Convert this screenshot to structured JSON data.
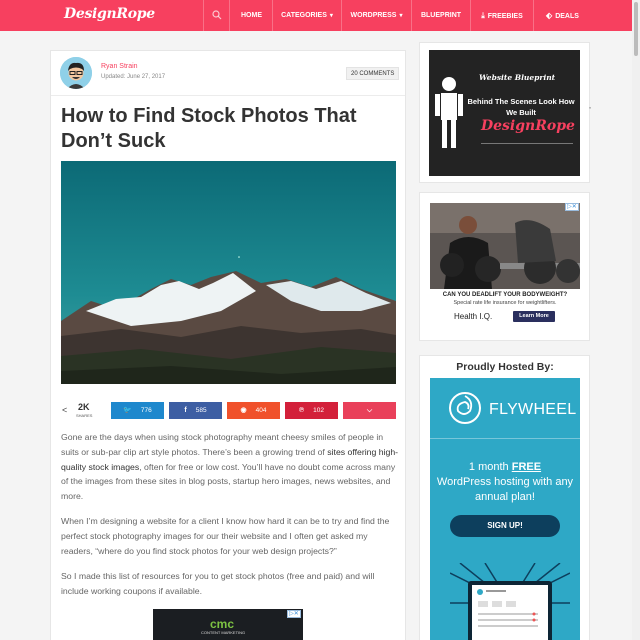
{
  "nav": {
    "logo": "DesignRope",
    "items": [
      {
        "label": "HOME"
      },
      {
        "label": "CATEGORIES",
        "chevron": "▾"
      },
      {
        "label": "WORDPRESS",
        "chevron": "▾"
      },
      {
        "label": "BLUEPRINT"
      },
      {
        "label": "FREEBIES",
        "icon": "download-icon"
      },
      {
        "label": "DEALS",
        "icon": "tag-icon"
      }
    ]
  },
  "post": {
    "author": "Ryan Strain",
    "updated": "Updated: June 27, 2017",
    "comments": "20 COMMENTS",
    "title": "How to Find Stock Photos That Don’t Suck",
    "share_total": "2K",
    "share_total_label": "SHARES",
    "shares": [
      {
        "network": "twitter",
        "count": "776",
        "color": "#1e88cd",
        "icon": "twitter-icon"
      },
      {
        "network": "facebook",
        "count": "585",
        "color": "#3d5ea3",
        "icon": "facebook-icon"
      },
      {
        "network": "reddit",
        "count": "404",
        "color": "#f0512b",
        "icon": "reddit-icon"
      },
      {
        "network": "pinterest",
        "count": "102",
        "color": "#d3203a",
        "icon": "pinterest-icon"
      },
      {
        "network": "pocket",
        "count": "",
        "color": "#e9405a",
        "icon": "pocket-icon"
      }
    ],
    "para1_a": "Gone are the days when using stock photography meant cheesy smiles of people in suits or sub-par clip art style photos. There’s been a growing trend of ",
    "para1_link": "sites offering high-quality stock images",
    "para1_b": ", often for free or low cost. You’ll have no doubt come across many of the images from these sites in blog posts, startup hero images, news websites, and more.",
    "para2": "When I’m designing a website for a client I know how hard it can be to try and find the perfect stock photography images for our their website and I often get asked my readers, “where do you find stock photos for your web design projects?”",
    "para3": "So I made this list of resources for you to get stock photos (free and paid) and will include working coupons if available.",
    "inline_ad": {
      "logo": "cmc",
      "subtitle": "CONTENT MARKETING"
    }
  },
  "sidebar": {
    "blueprint_ad": {
      "heading": "Website Blueprint",
      "line": "Behind The Scenes Look How We Built",
      "logo": "DesignRope"
    },
    "health_ad": {
      "question": "CAN YOU DEADLIFT YOUR BODYWEIGHT?",
      "subtitle": "Special rate life insurance for weightlifters.",
      "brand": "Health I.Q.",
      "cta": "Learn More"
    },
    "hosted": {
      "title": "Proudly Hosted By:",
      "brand": "FLYWHEEL",
      "offer_pre": "1 month ",
      "offer_free": "FREE",
      "offer_rest": "WordPress hosting with any annual plan!",
      "cta": "SIGN UP!"
    }
  },
  "colors": {
    "brand": "#f7405f",
    "flywheel": "#2ea8c6",
    "cta_dark": "#0d3f5d"
  }
}
